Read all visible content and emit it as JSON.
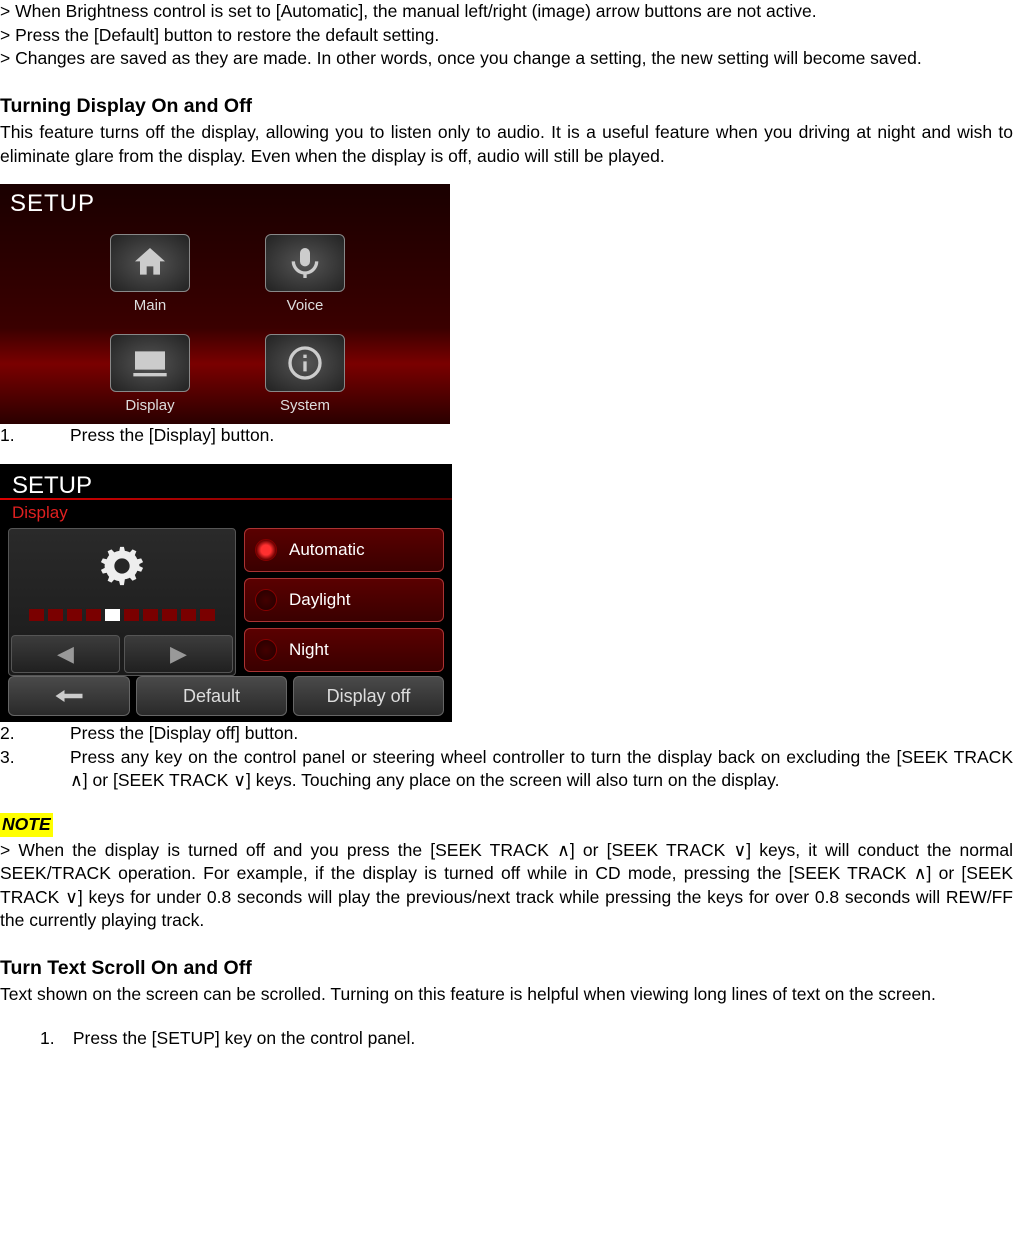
{
  "intro_notes": [
    "When Brightness control is set to [Automatic], the manual left/right (image) arrow buttons are not active.",
    "Press the [Default] button to restore the default setting.",
    "Changes are saved as they are made. In other words, once you change a setting, the new setting will become saved."
  ],
  "section_turning": {
    "heading": "Turning Display On and Off",
    "desc": "This feature turns off the display, allowing you to listen only to audio. It is a useful feature when you driving at night and wish to eliminate glare from the display. Even when the display is off, audio will still be played."
  },
  "shot1": {
    "title": "SETUP",
    "tiles": [
      {
        "label": "Main",
        "icon": "home-icon"
      },
      {
        "label": "Voice",
        "icon": "mic-icon"
      },
      {
        "label": "Display",
        "icon": "display-icon"
      },
      {
        "label": "System",
        "icon": "info-icon"
      }
    ]
  },
  "steps1": [
    {
      "num": "1.",
      "text": "Press the [Display] button."
    }
  ],
  "shot2": {
    "title": "SETUP",
    "subtitle": "Display",
    "brightness_ticks": 10,
    "brightness_active": 5,
    "options": [
      {
        "label": "Automatic",
        "selected": true
      },
      {
        "label": "Daylight",
        "selected": false
      },
      {
        "label": "Night",
        "selected": false
      }
    ],
    "buttons": {
      "back": "back",
      "default": "Default",
      "display_off": "Display off"
    }
  },
  "steps2": [
    {
      "num": "2.",
      "text": "Press the [Display off] button."
    },
    {
      "num": "3.",
      "text": "Press any key on the control panel or steering wheel controller to turn the display back on excluding the [SEEK TRACK ∧] or [SEEK TRACK ∨] keys. Touching any place on the screen will also turn on the display."
    }
  ],
  "note": {
    "label": "NOTE",
    "text": "When the display is turned off and you press the [SEEK TRACK ∧] or [SEEK TRACK ∨] keys, it will conduct the normal SEEK/TRACK operation. For example, if the display is turned off while in CD mode, pressing the [SEEK TRACK ∧] or [SEEK TRACK ∨] keys for under 0.8 seconds will play the previous/next track while pressing the keys for over 0.8 seconds will REW/FF the currently playing track."
  },
  "section_scroll": {
    "heading": "Turn Text Scroll On and Off",
    "desc": "Text shown on the screen can be scrolled. Turning on this feature is helpful when viewing long lines of text on the screen."
  },
  "steps3": [
    {
      "num": "1.",
      "text": "Press the [SETUP] key on the control panel."
    }
  ]
}
